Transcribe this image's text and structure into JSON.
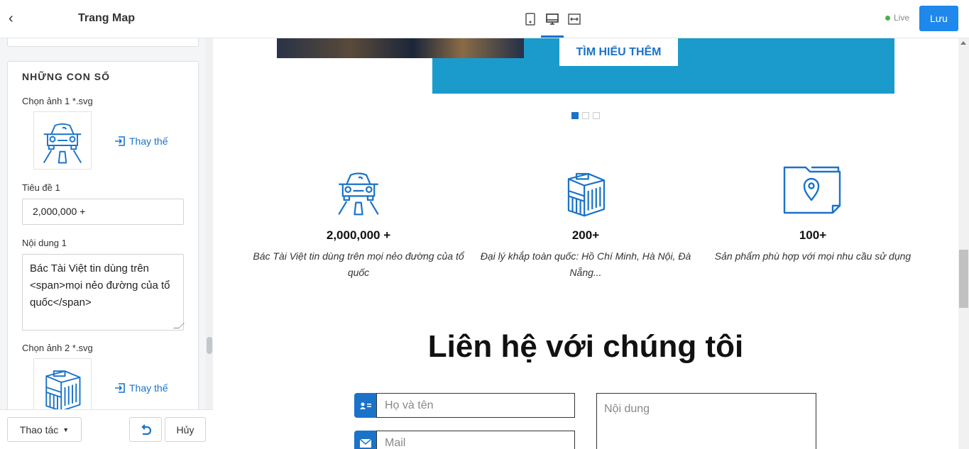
{
  "sidebar": {
    "title": "Trang Map",
    "section_title": "NHỮNG CON SỐ",
    "image1_label": "Chọn ảnh 1 *.svg",
    "replace_label": "Thay thế",
    "title1_label": "Tiêu đề 1",
    "title1_value": "2,000,000 +",
    "content1_label": "Nội dung 1",
    "content1_value": "Bác Tài Việt tin dùng trên <span>mọi nẻo đường của tổ quốc</span>",
    "image2_label": "Chọn ảnh 2 *.svg",
    "footer": {
      "actions_label": "Thao tác",
      "cancel_label": "Hủy"
    }
  },
  "topbar": {
    "live_label": "Live",
    "save_label": "Lưu"
  },
  "preview": {
    "learn_more": "TÌM HIỂU THÊM",
    "slider_active_index": 0,
    "slider_count": 3,
    "stats": [
      {
        "number": "2,000,000 +",
        "desc": "Bác Tài Việt tin dùng trên mọi nẻo đường của tổ quốc",
        "icon": "car-road-icon"
      },
      {
        "number": "200+",
        "desc": "Đại lý khắp toàn quốc: Hồ Chí Minh, Hà Nội, Đà Nẵng...",
        "icon": "store-icon"
      },
      {
        "number": "100+",
        "desc": "Sản phẩm phù hợp với mọi nhu cầu sử dụng",
        "icon": "folder-location-icon"
      }
    ],
    "contact_title": "Liên hệ với chúng tôi",
    "name_placeholder": "Họ và tên",
    "mail_placeholder": "Mail",
    "message_placeholder": "Nội dung"
  },
  "colors": {
    "accent": "#1a73c9",
    "banner": "#1b9bcc",
    "save": "#1e88ec",
    "live": "#4caf50"
  }
}
